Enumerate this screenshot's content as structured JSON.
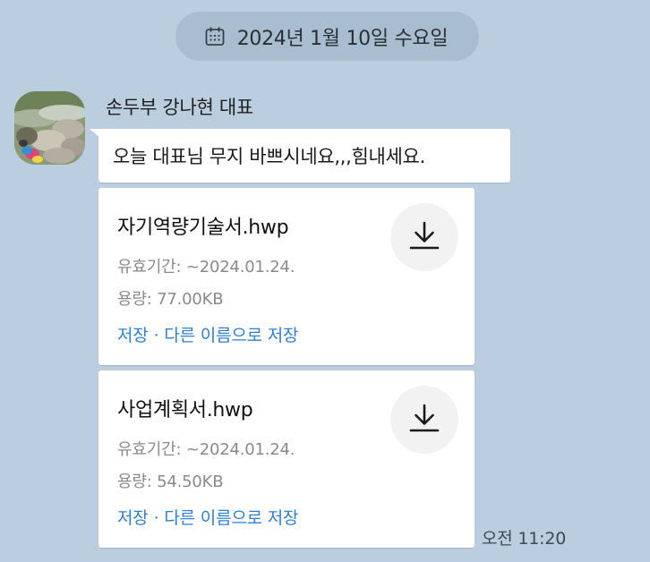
{
  "date_divider": {
    "icon": "calendar-icon",
    "text": "2024년 1월 10일 수요일"
  },
  "message": {
    "sender": "손두부 강나현 대표",
    "avatar_icon": "profile-photo",
    "text": "오늘 대표님 무지 바쁘시네요,,,힘내세요.",
    "time": "오전 11:20"
  },
  "files": [
    {
      "name": "자기역량기술서.hwp",
      "expiry": "유효기간: ~2024.01.24.",
      "size": "용량: 77.00KB",
      "save_label": "저장",
      "separator": "·",
      "save_as_label": "다른 이름으로 저장"
    },
    {
      "name": "사업계획서.hwp",
      "expiry": "유효기간: ~2024.01.24.",
      "size": "용량: 54.50KB",
      "save_label": "저장",
      "separator": "·",
      "save_as_label": "다른 이름으로 저장"
    }
  ],
  "colors": {
    "background": "#bacedf",
    "date_pill": "#a9bdd0",
    "link": "#2f7fd0",
    "meta_text": "#8a8a8a"
  }
}
